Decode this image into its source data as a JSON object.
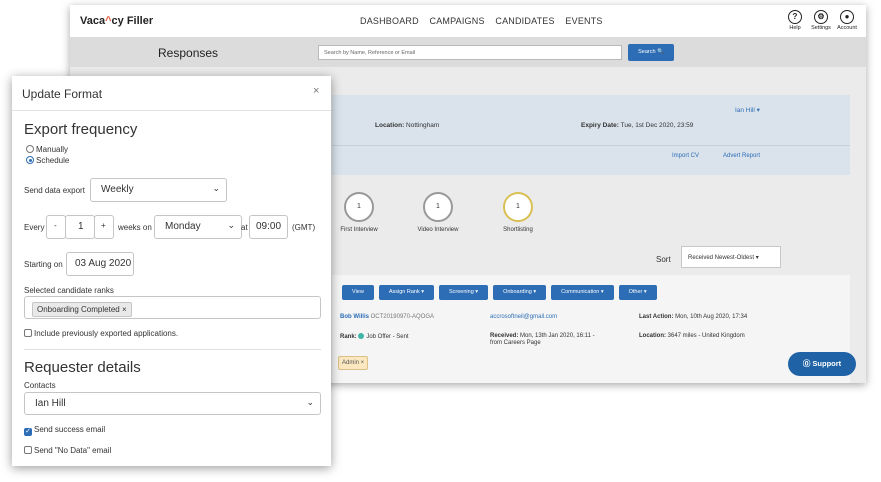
{
  "app": {
    "logo": {
      "pre": "Vaca",
      "mid": "^",
      "post": "cy Filler"
    },
    "nav": [
      "DASHBOARD",
      "CAMPAIGNS",
      "CANDIDATES",
      "EVENTS"
    ],
    "top_icons": [
      {
        "label": "Help",
        "glyph": "?",
        "icon": "help-icon"
      },
      {
        "label": "Settings",
        "glyph": "⚙",
        "icon": "settings-icon"
      },
      {
        "label": "Account",
        "glyph": "●",
        "icon": "account-icon"
      }
    ],
    "page_title": "Responses",
    "search": {
      "placeholder": "Search by Name, Reference or Email",
      "button": "Search 🔍"
    }
  },
  "job": {
    "owner": "Ian Hill ▾",
    "location_label": "Location:",
    "location_value": " Nottingham",
    "expiry_label": "Expiry Date:",
    "expiry_value": " Tue, 1st Dec 2020, 23:59",
    "links": [
      "Import CV",
      "Advert Report"
    ]
  },
  "stages": [
    {
      "count": "1",
      "label": "First Interview",
      "highlight": false
    },
    {
      "count": "1",
      "label": "Video Interview",
      "highlight": false
    },
    {
      "count": "1",
      "label": "Shortlisting",
      "highlight": true
    }
  ],
  "sort": {
    "label": "Sort",
    "value": "Received Newest-Oldest ▾"
  },
  "actions": [
    "View",
    "Assign Rank ▾",
    "Screening ▾",
    "Onboarding ▾",
    "Communication ▾",
    "Other ▾"
  ],
  "candidate": {
    "name": "Bob Willis",
    "ref": " OCT20190970-AQOGA",
    "email": "accrosoftneil@gmail.com",
    "last_action_label": "Last Action:",
    "last_action_value": " Mon, 10th Aug 2020, 17:34",
    "rank_label": "Rank:",
    "rank_value": "Job Offer - Sent",
    "received_label": "Received:",
    "received_value": " Mon, 13th Jan 2020, 16:11 -",
    "received_source": "from Careers Page",
    "location_label": "Location:",
    "location_value": " 3647 miles - United Kingdom",
    "tag": "Admin ×"
  },
  "support": "⓪ Support",
  "modal": {
    "title": "Update Format",
    "close": "×",
    "export_heading": "Export frequency",
    "radio_manual": "Manually",
    "radio_schedule": "Schedule",
    "send_label": "Send data export",
    "send_value": "Weekly",
    "every_label": "Every",
    "minus": "-",
    "every_value": "1",
    "plus": "+",
    "weeks_on": "weeks on",
    "day_value": "Monday",
    "at_label": "at",
    "time_value": "09:00",
    "tz": "(GMT)",
    "starting_label": "Starting on",
    "start_value": "03 Aug 2020",
    "ranks_label": "Selected candidate ranks",
    "rank_tag": "Onboarding Completed ×",
    "include_label": "Include previously exported applications.",
    "requester_heading": "Requester details",
    "contacts_label": "Contacts",
    "contact_value": "Ian Hill",
    "success_label": "Send success email",
    "nodata_label": "Send \"No Data\" email"
  }
}
